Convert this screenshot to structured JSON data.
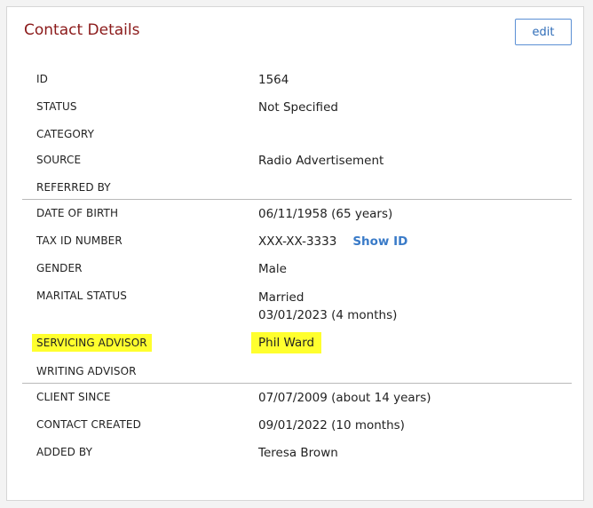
{
  "card": {
    "title": "Contact Details",
    "edit_label": "edit"
  },
  "sections": [
    {
      "rows": [
        {
          "label": "ID",
          "value": "1564"
        },
        {
          "label": "STATUS",
          "value": "Not Specified"
        },
        {
          "label": "CATEGORY",
          "value": ""
        },
        {
          "label": "SOURCE",
          "value": "Radio Advertisement"
        },
        {
          "label": "REFERRED BY",
          "value": ""
        }
      ]
    },
    {
      "rows": [
        {
          "label": "DATE OF BIRTH",
          "value": "06/11/1958 (65 years)"
        },
        {
          "label": "TAX ID NUMBER",
          "value": "XXX-XX-3333",
          "link": "Show ID"
        },
        {
          "label": "GENDER",
          "value": "Male"
        },
        {
          "label": "MARITAL STATUS",
          "value": "Married",
          "value2": "03/01/2023 (4 months)"
        },
        {
          "label": "SERVICING ADVISOR",
          "value": "Phil Ward",
          "highlight": true
        },
        {
          "label": "WRITING ADVISOR",
          "value": ""
        }
      ]
    },
    {
      "rows": [
        {
          "label": "CLIENT SINCE",
          "value": "07/07/2009 (about 14 years)"
        },
        {
          "label": "CONTACT CREATED",
          "value": "09/01/2022 (10 months)"
        },
        {
          "label": "ADDED BY",
          "value": "Teresa Brown"
        }
      ]
    }
  ],
  "colors": {
    "title": "#8b1a1a",
    "link": "#3a7bc8",
    "highlight": "#ffff2e",
    "button_border": "#5b8fd4"
  }
}
